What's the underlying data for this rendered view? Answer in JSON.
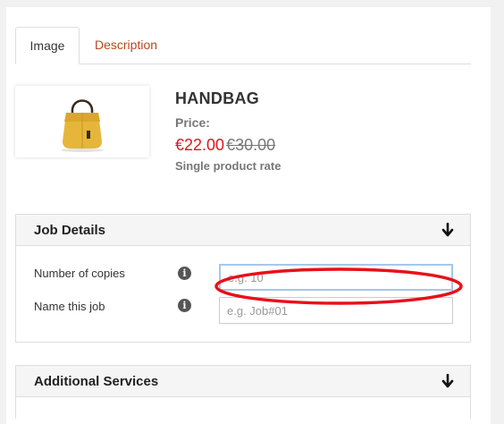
{
  "tabs": [
    {
      "label": "Image",
      "active": true
    },
    {
      "label": "Description",
      "active": false
    }
  ],
  "product": {
    "name": "HANDBAG",
    "price_label": "Price:",
    "price_current": "€22.00",
    "price_old": "€30.00",
    "rate": "Single product rate",
    "image_icon": "handbag-image"
  },
  "job_details": {
    "title": "Job Details",
    "fields": [
      {
        "label": "Number of copies",
        "placeholder": "e.g. 10",
        "value": ""
      },
      {
        "label": "Name this job",
        "placeholder": "e.g. Job#01",
        "value": ""
      }
    ]
  },
  "additional_services": {
    "title": "Additional Services"
  },
  "colors": {
    "accent_tab": "#b8461f",
    "price_red": "#e0141e",
    "annotation_red": "#e8101a",
    "focus_border": "#a6c8ea"
  }
}
